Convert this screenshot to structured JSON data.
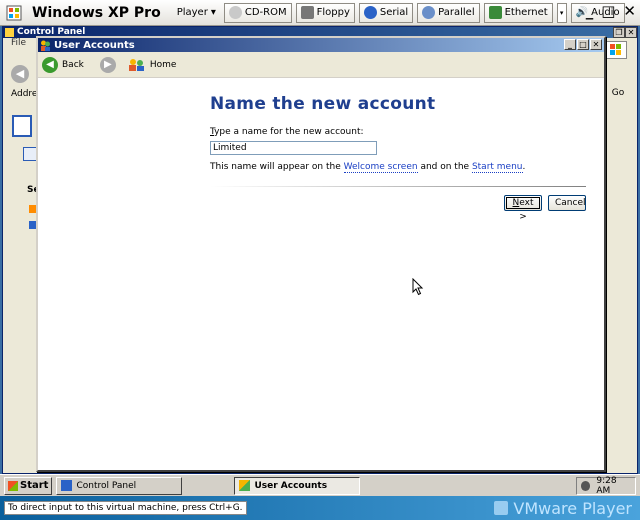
{
  "vmware": {
    "title": "Windows XP Pro",
    "player_menu": "Player",
    "devices": [
      "CD-ROM",
      "Floppy",
      "Serial",
      "Parallel",
      "Ethernet",
      "Audio"
    ],
    "status_message": "To direct input to this virtual machine, press Ctrl+G.",
    "brand": "VMware Player"
  },
  "control_panel": {
    "title": "Control Panel",
    "menu_first": "File",
    "address_label": "Addre",
    "go_label": "Go",
    "side_section": "Se"
  },
  "user_accounts": {
    "title": "User Accounts",
    "nav": {
      "back_label": "Back",
      "home_label": "Home"
    },
    "heading": "Name the new account",
    "prompt_access_key": "T",
    "prompt_rest": "ype a name for the new account:",
    "account_name_value": "Limited",
    "note_prefix": "This name will appear on the ",
    "note_link1": "Welcome screen",
    "note_mid": " and on the ",
    "note_link2": "Start menu",
    "note_suffix": ".",
    "next_access_key": "N",
    "next_rest": "ext >",
    "cancel_label": "Cancel"
  },
  "taskbar": {
    "start_label": "Start",
    "tasks": [
      "Control Panel",
      "User Accounts"
    ],
    "clock": "9:28 AM"
  },
  "colors": {
    "heading_blue": "#1f3f8f",
    "link_blue": "#1a3fc4",
    "titlebar_blue": "#0a246a"
  }
}
